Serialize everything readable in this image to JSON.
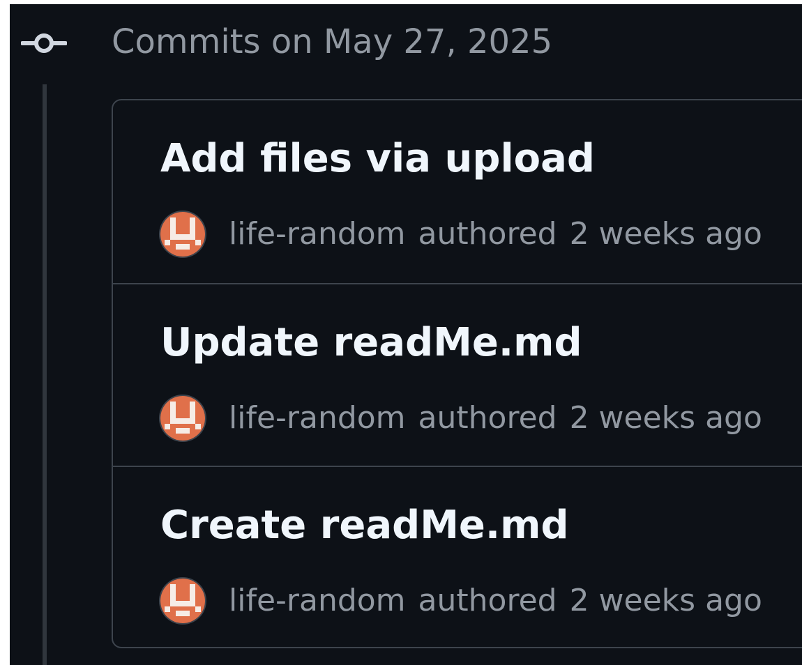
{
  "group": {
    "icon": "git-commit-icon",
    "title": "Commits on May 27, 2025"
  },
  "commits": [
    {
      "title": "Add files via upload",
      "avatar_icon": "identicon-avatar",
      "author": "life-random",
      "action": "authored",
      "time": "2 weeks ago"
    },
    {
      "title": "Update readMe.md",
      "avatar_icon": "identicon-avatar",
      "author": "life-random",
      "action": "authored",
      "time": "2 weeks ago"
    },
    {
      "title": "Create readMe.md",
      "avatar_icon": "identicon-avatar",
      "author": "life-random",
      "action": "authored",
      "time": "2 weeks ago"
    }
  ],
  "colors": {
    "background": "#0d1117",
    "border": "#3d444d",
    "title_text": "#f0f6fc",
    "muted_text": "#9198a1",
    "avatar_accent": "#e0704a"
  }
}
